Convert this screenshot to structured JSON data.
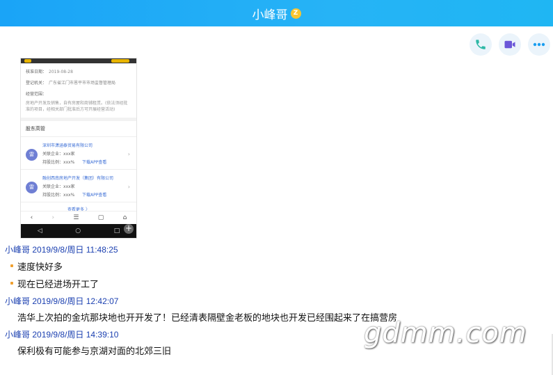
{
  "window": {
    "title": "小峰哥",
    "title_badge": "Z"
  },
  "toolbar": {
    "icons": [
      "phone-call-icon",
      "video-call-icon",
      "more-icon"
    ],
    "colors": {
      "phone": "#2db8a6",
      "video": "#6a56d8",
      "more": "#1a9ef0"
    }
  },
  "screenshot": {
    "approval_date_label": "核准日期：",
    "approval_date": "2019-08-28",
    "registration_label": "登记机关：",
    "registration": "广东省江门市恩平市市场监督管理局",
    "scope_label": "经营范围：",
    "scope_text": "房地产开发及销售，自有房屋和商铺租赁。(依法须经批准的项目，经相关部门批准后方可开展经营活动)",
    "section_title": "股东高管",
    "shareholders": [
      {
        "avatar": "雷",
        "name": "深圳市潇涵泰贸易有限公司",
        "related_label": "关联企业：",
        "related": "xxx家",
        "ratio_label": "持股比例：",
        "ratio": "xxx%",
        "link": "下载APP查看"
      },
      {
        "avatar": "雷",
        "name": "融创西南房地产开发（集团）有限公司",
        "related_label": "关联企业：",
        "related": "xxx家",
        "ratio_label": "持股比例：",
        "ratio": "xxx%",
        "link": "下载APP查看"
      }
    ],
    "more_link": "查看更多 〉"
  },
  "messages": [
    {
      "sender": "小峰哥",
      "time": "2019/9/8/周日 11:48:25",
      "lines": [
        "速度快好多",
        "现在已经进场开工了"
      ],
      "bulleted": true
    },
    {
      "sender": "小峰哥",
      "time": "2019/9/8/周日 12:42:07",
      "lines": [
        "浩华上次拍的金坑那块地也开开发了！已经清表隔壁金老板的地块也开发已经围起来了在搞营房"
      ],
      "bulleted": false
    },
    {
      "sender": "小峰哥",
      "time": "2019/9/8/周日 14:39:10",
      "lines": [
        "保利极有可能参与京湖对面的北郊三旧"
      ],
      "bulleted": false
    }
  ],
  "watermark": "gdmm.com"
}
